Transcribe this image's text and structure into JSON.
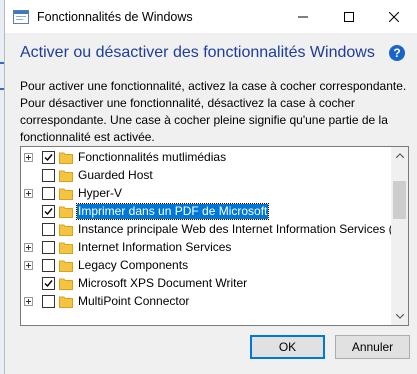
{
  "window": {
    "title": "Fonctionnalités de Windows"
  },
  "header": {
    "heading": "Activer ou désactiver des fonctionnalités Windows",
    "help_icon": "question-mark-icon"
  },
  "description": {
    "line1": "Pour activer une fonctionnalité, activez la case à cocher correspondante.",
    "line2": "Pour désactiver une fonctionnalité, désactivez la case à cocher",
    "line3": "correspondante. Une case à cocher pleine signifie qu'une partie de la",
    "line4": "fonctionnalité est activée."
  },
  "features": [
    {
      "label": "Fonctionnalités mutlimédias",
      "expandable": true,
      "state": "checked",
      "selected": false
    },
    {
      "label": "Guarded Host",
      "expandable": false,
      "state": "unchecked",
      "selected": false
    },
    {
      "label": "Hyper-V",
      "expandable": true,
      "state": "unchecked",
      "selected": false
    },
    {
      "label": "Imprimer dans un PDF de Microsoft",
      "expandable": false,
      "state": "checked",
      "selected": true
    },
    {
      "label": "Instance principale Web des Internet Information Services (IIS",
      "expandable": false,
      "state": "unchecked",
      "selected": false
    },
    {
      "label": "Internet Information Services",
      "expandable": true,
      "state": "unchecked",
      "selected": false
    },
    {
      "label": "Legacy Components",
      "expandable": true,
      "state": "unchecked",
      "selected": false
    },
    {
      "label": "Microsoft XPS Document Writer",
      "expandable": false,
      "state": "checked",
      "selected": false
    },
    {
      "label": "MultiPoint Connector",
      "expandable": true,
      "state": "unchecked",
      "selected": false
    }
  ],
  "buttons": {
    "ok": "OK",
    "cancel": "Annuler"
  },
  "colors": {
    "heading": "#1c3d9c",
    "selection": "#0078d7",
    "folder": "#f5c342"
  }
}
